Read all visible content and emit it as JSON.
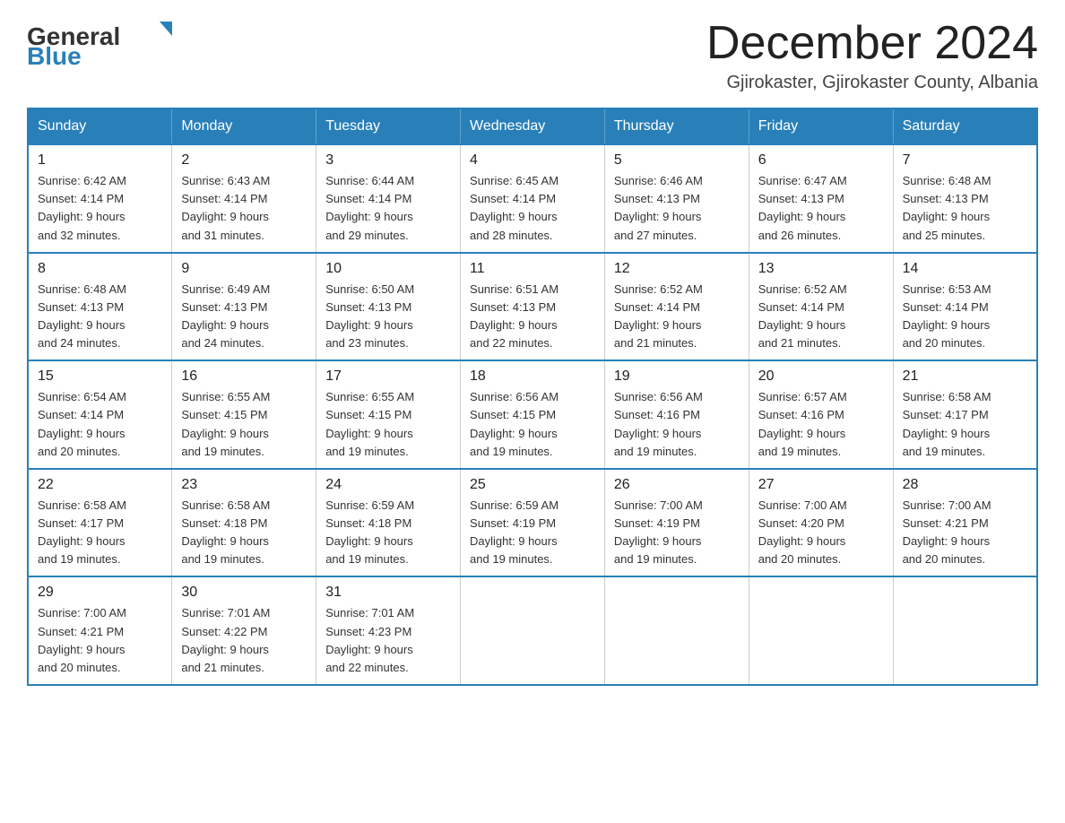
{
  "header": {
    "logo_general": "General",
    "logo_blue": "Blue",
    "month_title": "December 2024",
    "location": "Gjirokaster, Gjirokaster County, Albania"
  },
  "weekdays": [
    "Sunday",
    "Monday",
    "Tuesday",
    "Wednesday",
    "Thursday",
    "Friday",
    "Saturday"
  ],
  "weeks": [
    [
      {
        "day": "1",
        "sunrise": "6:42 AM",
        "sunset": "4:14 PM",
        "daylight": "9 hours and 32 minutes."
      },
      {
        "day": "2",
        "sunrise": "6:43 AM",
        "sunset": "4:14 PM",
        "daylight": "9 hours and 31 minutes."
      },
      {
        "day": "3",
        "sunrise": "6:44 AM",
        "sunset": "4:14 PM",
        "daylight": "9 hours and 29 minutes."
      },
      {
        "day": "4",
        "sunrise": "6:45 AM",
        "sunset": "4:14 PM",
        "daylight": "9 hours and 28 minutes."
      },
      {
        "day": "5",
        "sunrise": "6:46 AM",
        "sunset": "4:13 PM",
        "daylight": "9 hours and 27 minutes."
      },
      {
        "day": "6",
        "sunrise": "6:47 AM",
        "sunset": "4:13 PM",
        "daylight": "9 hours and 26 minutes."
      },
      {
        "day": "7",
        "sunrise": "6:48 AM",
        "sunset": "4:13 PM",
        "daylight": "9 hours and 25 minutes."
      }
    ],
    [
      {
        "day": "8",
        "sunrise": "6:48 AM",
        "sunset": "4:13 PM",
        "daylight": "9 hours and 24 minutes."
      },
      {
        "day": "9",
        "sunrise": "6:49 AM",
        "sunset": "4:13 PM",
        "daylight": "9 hours and 24 minutes."
      },
      {
        "day": "10",
        "sunrise": "6:50 AM",
        "sunset": "4:13 PM",
        "daylight": "9 hours and 23 minutes."
      },
      {
        "day": "11",
        "sunrise": "6:51 AM",
        "sunset": "4:13 PM",
        "daylight": "9 hours and 22 minutes."
      },
      {
        "day": "12",
        "sunrise": "6:52 AM",
        "sunset": "4:14 PM",
        "daylight": "9 hours and 21 minutes."
      },
      {
        "day": "13",
        "sunrise": "6:52 AM",
        "sunset": "4:14 PM",
        "daylight": "9 hours and 21 minutes."
      },
      {
        "day": "14",
        "sunrise": "6:53 AM",
        "sunset": "4:14 PM",
        "daylight": "9 hours and 20 minutes."
      }
    ],
    [
      {
        "day": "15",
        "sunrise": "6:54 AM",
        "sunset": "4:14 PM",
        "daylight": "9 hours and 20 minutes."
      },
      {
        "day": "16",
        "sunrise": "6:55 AM",
        "sunset": "4:15 PM",
        "daylight": "9 hours and 19 minutes."
      },
      {
        "day": "17",
        "sunrise": "6:55 AM",
        "sunset": "4:15 PM",
        "daylight": "9 hours and 19 minutes."
      },
      {
        "day": "18",
        "sunrise": "6:56 AM",
        "sunset": "4:15 PM",
        "daylight": "9 hours and 19 minutes."
      },
      {
        "day": "19",
        "sunrise": "6:56 AM",
        "sunset": "4:16 PM",
        "daylight": "9 hours and 19 minutes."
      },
      {
        "day": "20",
        "sunrise": "6:57 AM",
        "sunset": "4:16 PM",
        "daylight": "9 hours and 19 minutes."
      },
      {
        "day": "21",
        "sunrise": "6:58 AM",
        "sunset": "4:17 PM",
        "daylight": "9 hours and 19 minutes."
      }
    ],
    [
      {
        "day": "22",
        "sunrise": "6:58 AM",
        "sunset": "4:17 PM",
        "daylight": "9 hours and 19 minutes."
      },
      {
        "day": "23",
        "sunrise": "6:58 AM",
        "sunset": "4:18 PM",
        "daylight": "9 hours and 19 minutes."
      },
      {
        "day": "24",
        "sunrise": "6:59 AM",
        "sunset": "4:18 PM",
        "daylight": "9 hours and 19 minutes."
      },
      {
        "day": "25",
        "sunrise": "6:59 AM",
        "sunset": "4:19 PM",
        "daylight": "9 hours and 19 minutes."
      },
      {
        "day": "26",
        "sunrise": "7:00 AM",
        "sunset": "4:19 PM",
        "daylight": "9 hours and 19 minutes."
      },
      {
        "day": "27",
        "sunrise": "7:00 AM",
        "sunset": "4:20 PM",
        "daylight": "9 hours and 20 minutes."
      },
      {
        "day": "28",
        "sunrise": "7:00 AM",
        "sunset": "4:21 PM",
        "daylight": "9 hours and 20 minutes."
      }
    ],
    [
      {
        "day": "29",
        "sunrise": "7:00 AM",
        "sunset": "4:21 PM",
        "daylight": "9 hours and 20 minutes."
      },
      {
        "day": "30",
        "sunrise": "7:01 AM",
        "sunset": "4:22 PM",
        "daylight": "9 hours and 21 minutes."
      },
      {
        "day": "31",
        "sunrise": "7:01 AM",
        "sunset": "4:23 PM",
        "daylight": "9 hours and 22 minutes."
      },
      null,
      null,
      null,
      null
    ]
  ],
  "labels": {
    "sunrise": "Sunrise:",
    "sunset": "Sunset:",
    "daylight": "Daylight:"
  }
}
